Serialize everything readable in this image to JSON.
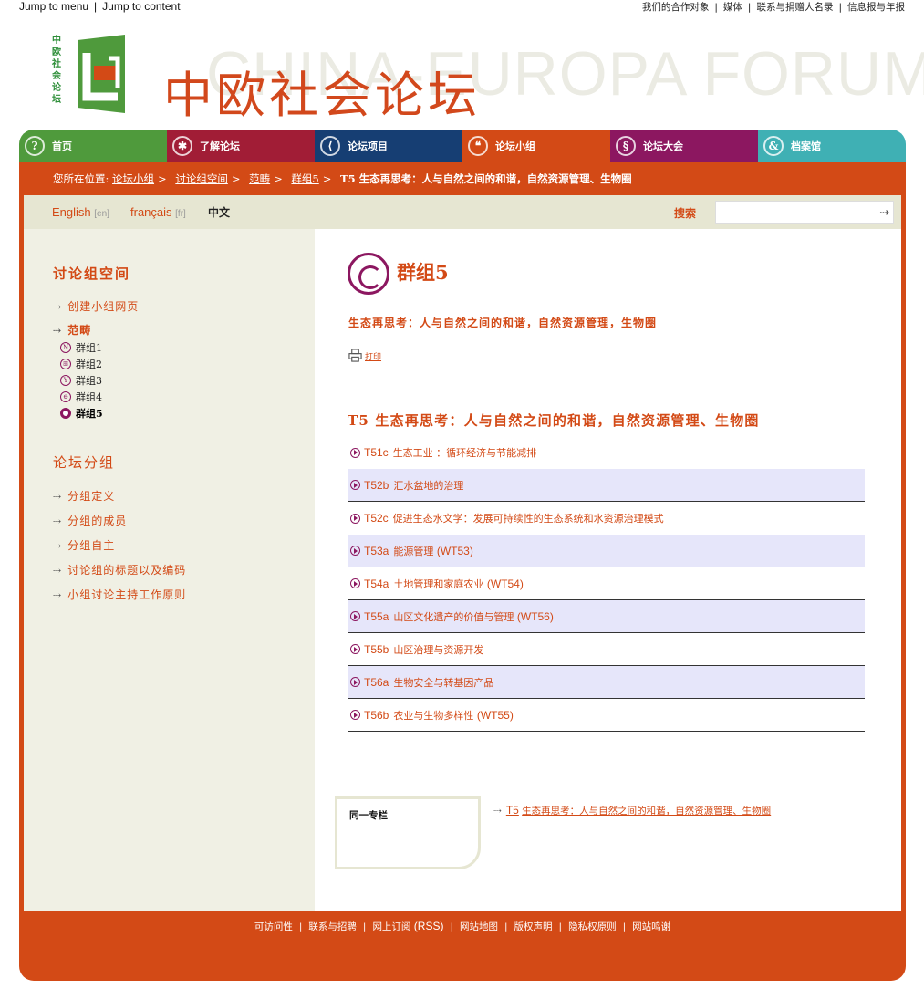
{
  "skip_links": {
    "menu": "Jump to menu",
    "content": "Jump to content",
    "sep": "|"
  },
  "utility_links": [
    "我们的合作对象",
    "媒体",
    "联系与捐赠人名录",
    "信息报与年报"
  ],
  "header": {
    "logo_vertical_text": "中欧社会论坛",
    "background_title": "CHINA-EUROPA FORUM",
    "title": "中欧社会论坛",
    "colors": {
      "green": "#4f9a3c",
      "orange": "#d34a16"
    }
  },
  "nav": [
    {
      "label": "首页",
      "icon": "question-icon",
      "glyph": "?",
      "color": "#4f9a3c"
    },
    {
      "label": "了解论坛",
      "icon": "star-icon",
      "glyph": "✱",
      "color": "#a11d36"
    },
    {
      "label": "论坛项目",
      "icon": "bracket-icon",
      "glyph": "⟨",
      "color": "#163e73"
    },
    {
      "label": "论坛小组",
      "icon": "quote-icon",
      "glyph": "❝",
      "color": "#d34a16"
    },
    {
      "label": "论坛大会",
      "icon": "section-icon",
      "glyph": "§",
      "color": "#8c1760"
    },
    {
      "label": "档案馆",
      "icon": "ampersand-icon",
      "glyph": "&",
      "color": "#3fb0b4"
    }
  ],
  "breadcrumb": {
    "prefix": "您所在位置:",
    "items": [
      "论坛小组",
      "讨论组空间",
      "范畴",
      "群组5"
    ],
    "gt": ">",
    "current": "T5 生态再思考：人与自然之间的和谐，自然资源管理、生物圈"
  },
  "languages": [
    {
      "name": "English",
      "code": "[en]"
    },
    {
      "name": "français",
      "code": "[fr]"
    },
    {
      "name": "中文",
      "code": ""
    }
  ],
  "search": {
    "label": "搜索",
    "placeholder": "",
    "go": "⇢"
  },
  "sidebar": {
    "section1_title": "讨论组空间",
    "create_link": "创建小组网页",
    "category_link": "范畴",
    "groups": [
      {
        "label": "群组1",
        "glyph": "N"
      },
      {
        "label": "群组2",
        "glyph": "ꕥ"
      },
      {
        "label": "群组3",
        "glyph": "Y"
      },
      {
        "label": "群组4",
        "glyph": "⊖"
      },
      {
        "label": "群组5",
        "glyph": ""
      }
    ],
    "section2_title": "论坛分组",
    "section2_links": [
      "分组定义",
      "分组的成员",
      "分组自主",
      "讨论组的标题以及编码",
      "小组讨论主持工作原则"
    ],
    "arrow": "⇢"
  },
  "main": {
    "group_title": "群组5",
    "subtitle": "生态再思考：人与自然之间的和谐，自然资源管理，生物圈",
    "print_label": "打印",
    "section_title": "T5 生态再思考：人与自然之间的和谐，自然资源管理、生物圈",
    "topics": [
      {
        "code": "T51c",
        "title": "生态工业 ：循环经济与节能减排",
        "suffix": ""
      },
      {
        "code": "T52b",
        "title": "汇水盆地的治理",
        "suffix": ""
      },
      {
        "code": "T52c",
        "title": "促进生态水文学：发展可持续性的生态系统和水资源治理模式",
        "suffix": ""
      },
      {
        "code": "T53a",
        "title": "能源管理",
        "suffix": "(WT53)"
      },
      {
        "code": "T54a",
        "title": "土地管理和家庭农业",
        "suffix": "(WT54)"
      },
      {
        "code": "T55a",
        "title": "山区文化遗产的价值与管理",
        "suffix": "(WT56)"
      },
      {
        "code": "T55b",
        "title": "山区治理与资源开发",
        "suffix": ""
      },
      {
        "code": "T56a",
        "title": "生物安全与转基因产品",
        "suffix": ""
      },
      {
        "code": "T56b",
        "title": "农业与生物多样性",
        "suffix": "(WT55)"
      }
    ],
    "same_column_label": "同一专栏",
    "same_column_link_code": "T5",
    "same_column_link_text": "生态再思考：人与自然之间的和谐，自然资源管理、生物圈"
  },
  "footer": {
    "links": [
      "可访问性",
      "联系与招聘",
      "网上订阅",
      "网站地图",
      "版权声明",
      "隐私权原则",
      "网站鸣谢"
    ],
    "rss": "(RSS)",
    "sep": "|"
  }
}
